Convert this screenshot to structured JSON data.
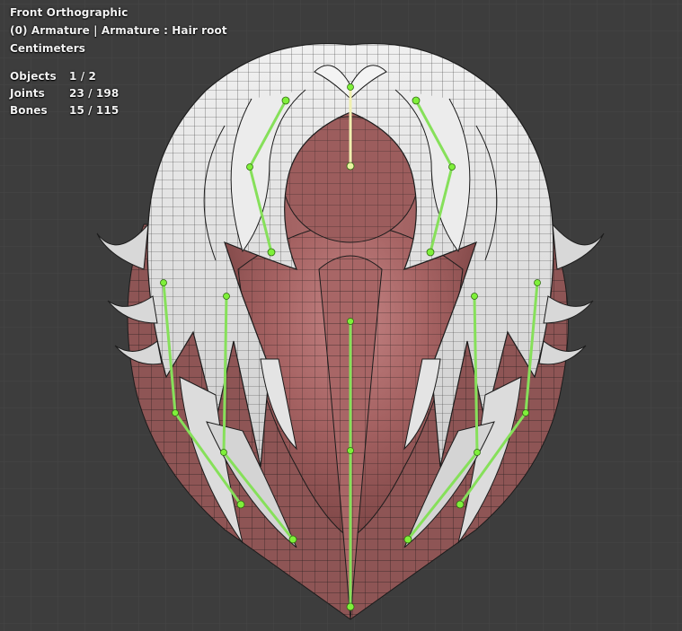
{
  "viewport": {
    "view_name": "Front Orthographic",
    "context": "(0) Armature | Armature : Hair root",
    "units": "Centimeters"
  },
  "stats": [
    {
      "label": "Objects",
      "value": "1 / 2"
    },
    {
      "label": "Joints",
      "value": "23 / 198"
    },
    {
      "label": "Bones",
      "value": "15 / 115"
    }
  ],
  "colors": {
    "background": "#3d3d3d",
    "grid": "#474747",
    "head_mesh": "#9a5a5a",
    "hair_mesh": "#e2e2e2",
    "wire": "#1c1c1c",
    "bone_selected": "#86e05a",
    "bone_active": "#f0f0b0",
    "joint": "#7ff03a"
  },
  "icons": [
    "armature-bone-icon",
    "joint-icon"
  ]
}
